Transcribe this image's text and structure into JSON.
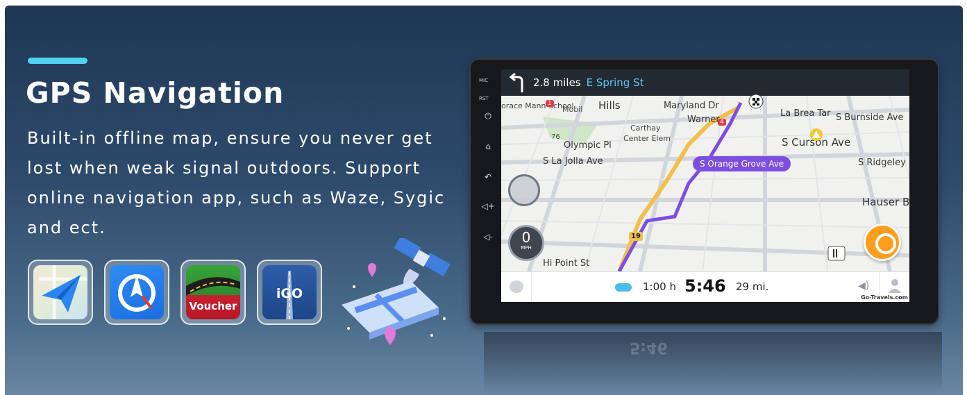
{
  "headline": "GPS Navigation",
  "description": "Built-in offline map, ensure you never get lost when weak signal outdoors. Support online navigation app, such as Waze, Sygic and ect.",
  "apps": [
    {
      "icon": "maps-navigation-app-icon"
    },
    {
      "icon": "compass-navigation-app-icon"
    },
    {
      "icon": "voucher-app-icon",
      "label": "Voucher"
    },
    {
      "icon": "igo-app-icon",
      "label": "iGO"
    }
  ],
  "device": {
    "hw_keys": {
      "mic": "MIC",
      "rst": "RST"
    },
    "nav": {
      "distance": "2.8 miles",
      "street": "E Spring St"
    },
    "map_labels": {
      "school": "orace Mann School",
      "mobil": "Mobil",
      "hills": "Hills",
      "maryland": "Maryland Dr",
      "warner": "Warner",
      "la_brea": "La Brea Tar",
      "burnside": "S Burnside Ave",
      "carthay": "Carthay",
      "center_elem": "Center Elem",
      "curson": "S Curson Ave",
      "olympic": "Olympic Pl",
      "route76": "76",
      "la_jolla": "S La Jolla Ave",
      "ridgeley": "S Ridgeley D",
      "hauser": "Hauser Bl",
      "hi_point": "Hi Point St",
      "route19": "19",
      "mobil_badge": "1",
      "warner_badge": "4"
    },
    "route_callout": "S Orange Grove Ave",
    "speed": {
      "value": "0",
      "unit": "MPH"
    },
    "bottom": {
      "duration": "1:00 h",
      "eta": "5:46",
      "remaining": "29 mi.",
      "watermark": "Go-Travels.com"
    }
  },
  "colors": {
    "accent": "#4fd2f0",
    "route": "#7d4fe0",
    "report": "#ff9d1f",
    "street_highlight": "#5ec5f2"
  }
}
